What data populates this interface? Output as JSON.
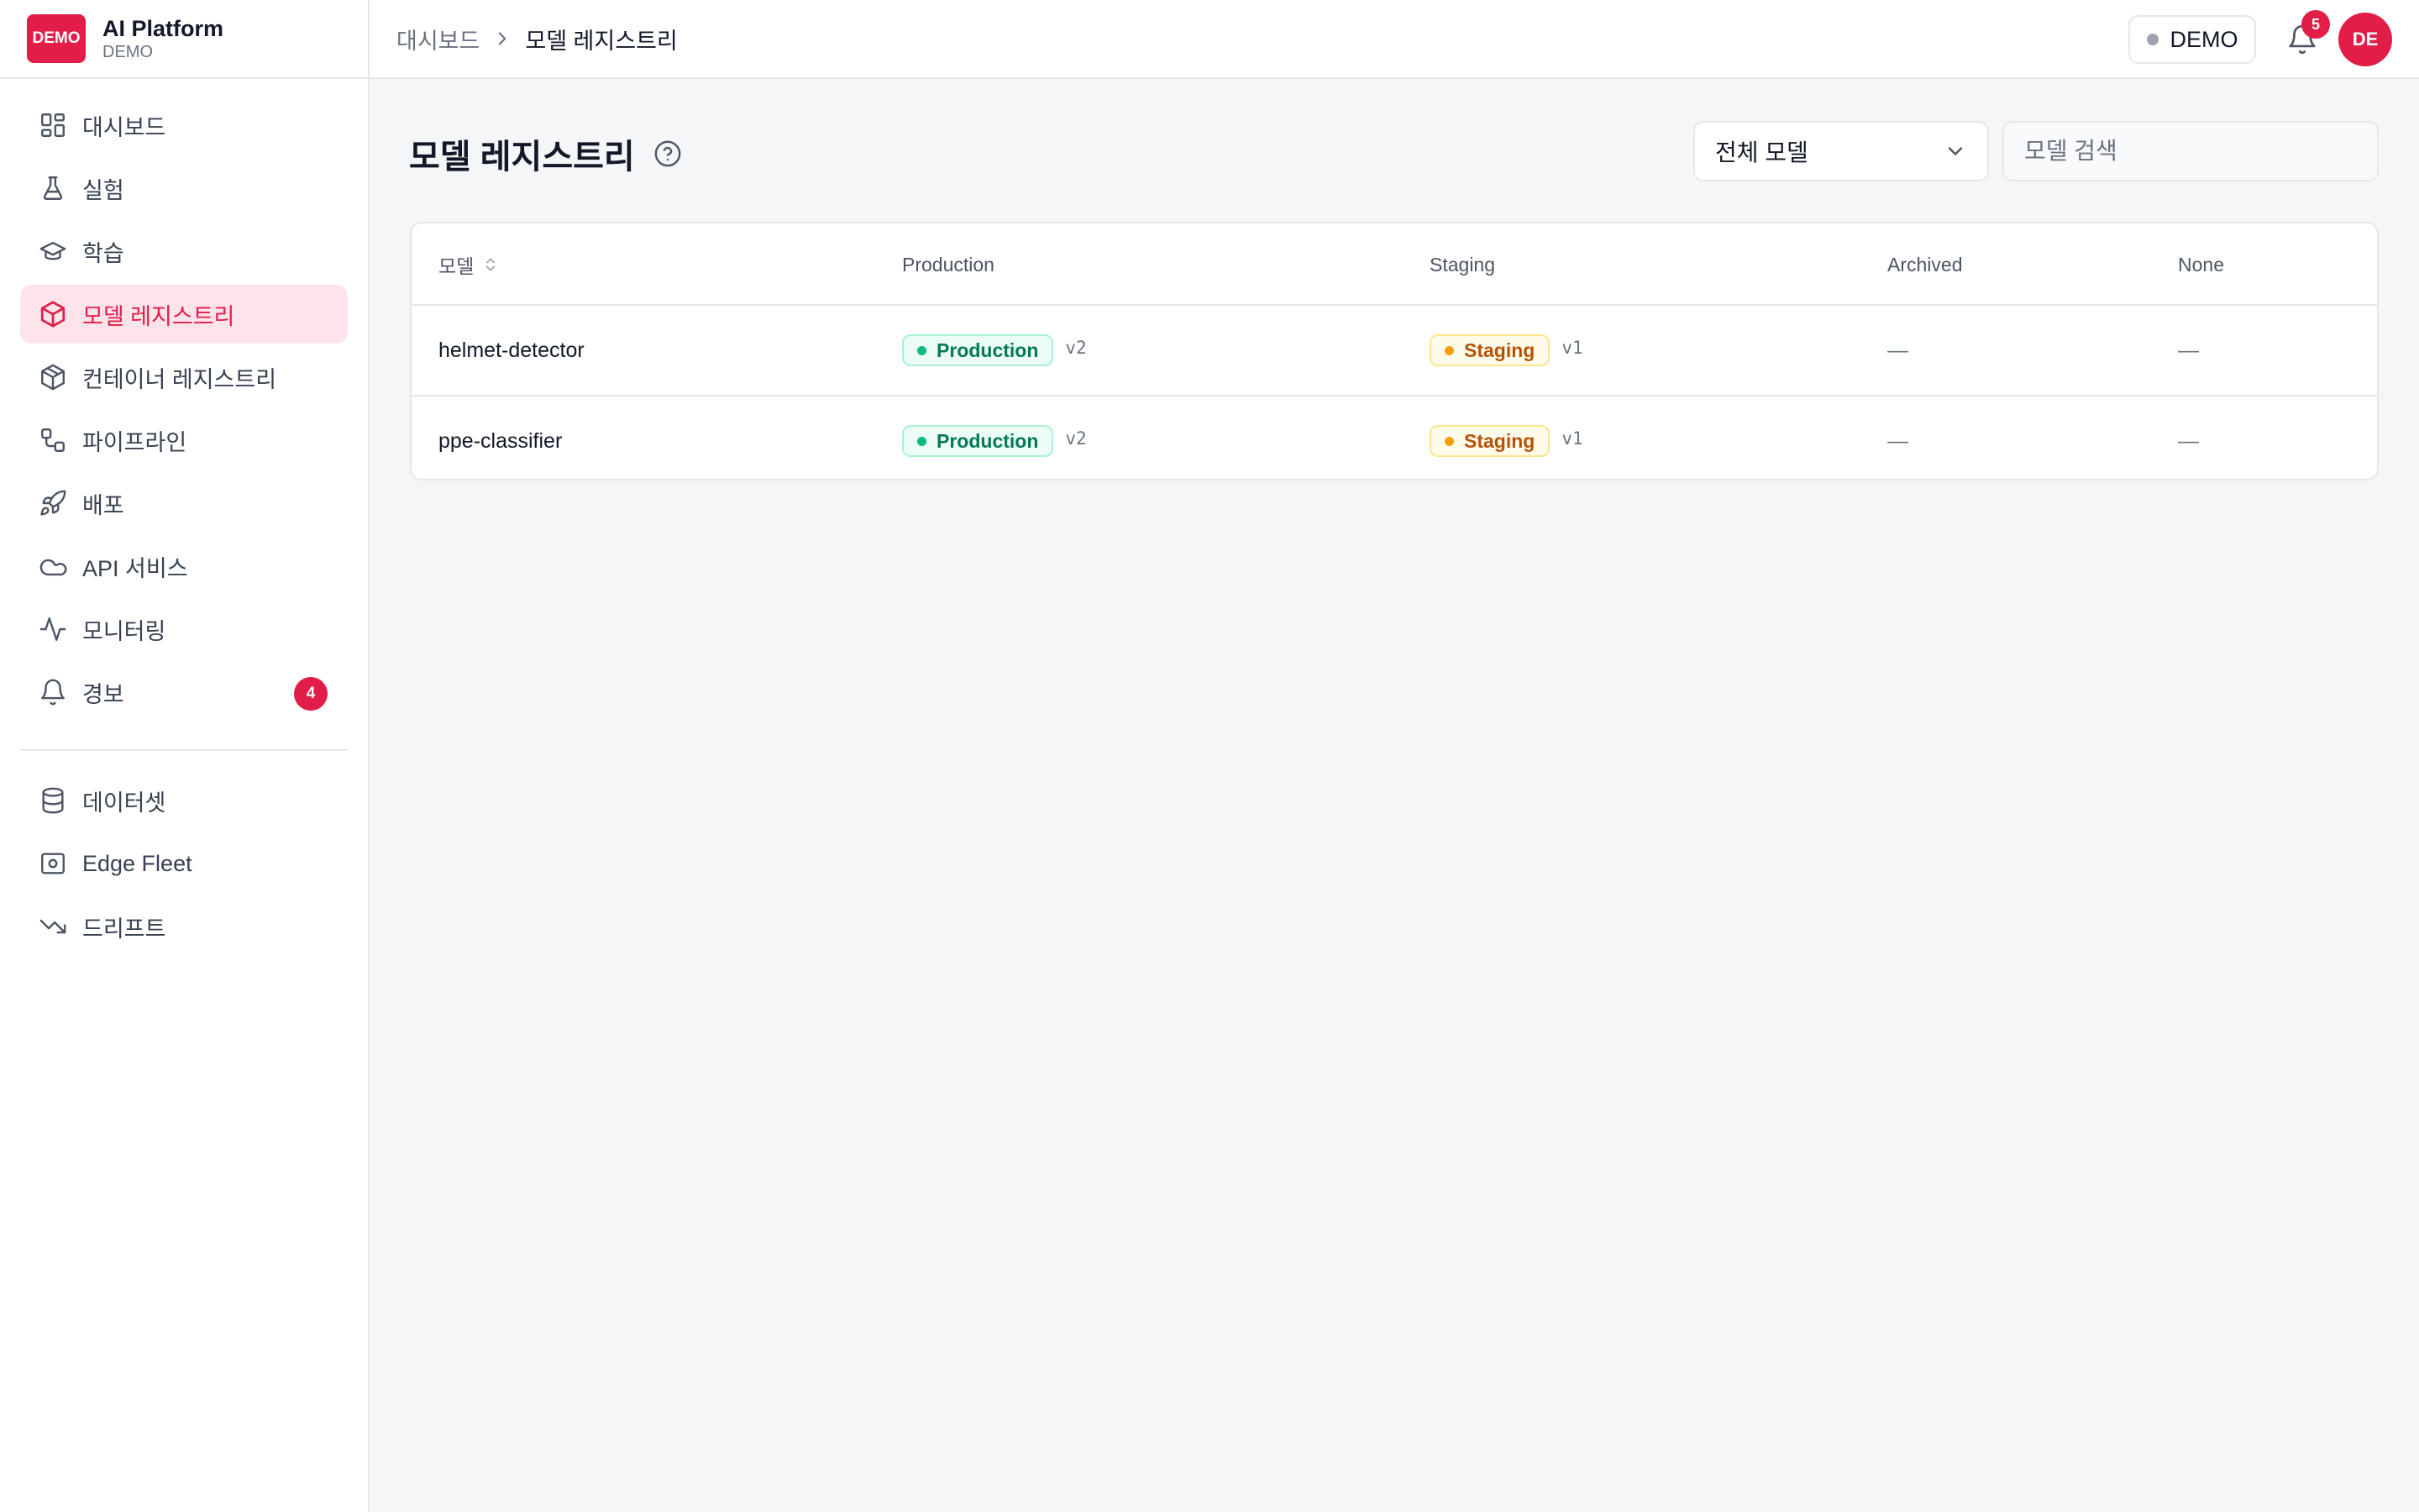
{
  "brand": {
    "logo_text": "DEMO",
    "name": "AI Platform",
    "sub": "DEMO"
  },
  "sidebar": {
    "items": [
      {
        "label": "대시보드",
        "icon": "dashboard-grid-icon"
      },
      {
        "label": "실험",
        "icon": "flask-icon"
      },
      {
        "label": "학습",
        "icon": "graduation-cap-icon"
      },
      {
        "label": "모델 레지스트리",
        "icon": "cube-icon",
        "active": true
      },
      {
        "label": "컨테이너 레지스트리",
        "icon": "package-icon"
      },
      {
        "label": "파이프라인",
        "icon": "workflow-icon"
      },
      {
        "label": "배포",
        "icon": "rocket-icon"
      },
      {
        "label": "API 서비스",
        "icon": "cloud-icon"
      },
      {
        "label": "모니터링",
        "icon": "activity-icon"
      },
      {
        "label": "경보",
        "icon": "bell-icon",
        "badge": "4"
      }
    ],
    "secondary_items": [
      {
        "label": "데이터셋",
        "icon": "database-icon"
      },
      {
        "label": "Edge Fleet",
        "icon": "edge-device-icon"
      },
      {
        "label": "드리프트",
        "icon": "trending-down-icon"
      }
    ]
  },
  "topbar": {
    "breadcrumb_root": "대시보드",
    "breadcrumb_current": "모델 레지스트리",
    "env_label": "DEMO",
    "notification_count": "5",
    "avatar_initials": "DE"
  },
  "page": {
    "title": "모델 레지스트리",
    "filter_selected": "전체 모델",
    "search_placeholder": "모델 검색"
  },
  "table": {
    "columns": [
      "모델",
      "Production",
      "Staging",
      "Archived",
      "None"
    ],
    "rows": [
      {
        "model": "helmet-detector",
        "production": {
          "label": "Production",
          "version": "v2"
        },
        "staging": {
          "label": "Staging",
          "version": "v1"
        },
        "archived": "—",
        "none": "—"
      },
      {
        "model": "ppe-classifier",
        "production": {
          "label": "Production",
          "version": "v2"
        },
        "staging": {
          "label": "Staging",
          "version": "v1"
        },
        "archived": "—",
        "none": "—"
      }
    ]
  },
  "colors": {
    "accent": "#e11d48",
    "active_bg": "#fde4ea",
    "production_text": "#047857",
    "production_bg": "#ecfdf5",
    "staging_text": "#b45309",
    "staging_bg": "#fffbeb"
  }
}
